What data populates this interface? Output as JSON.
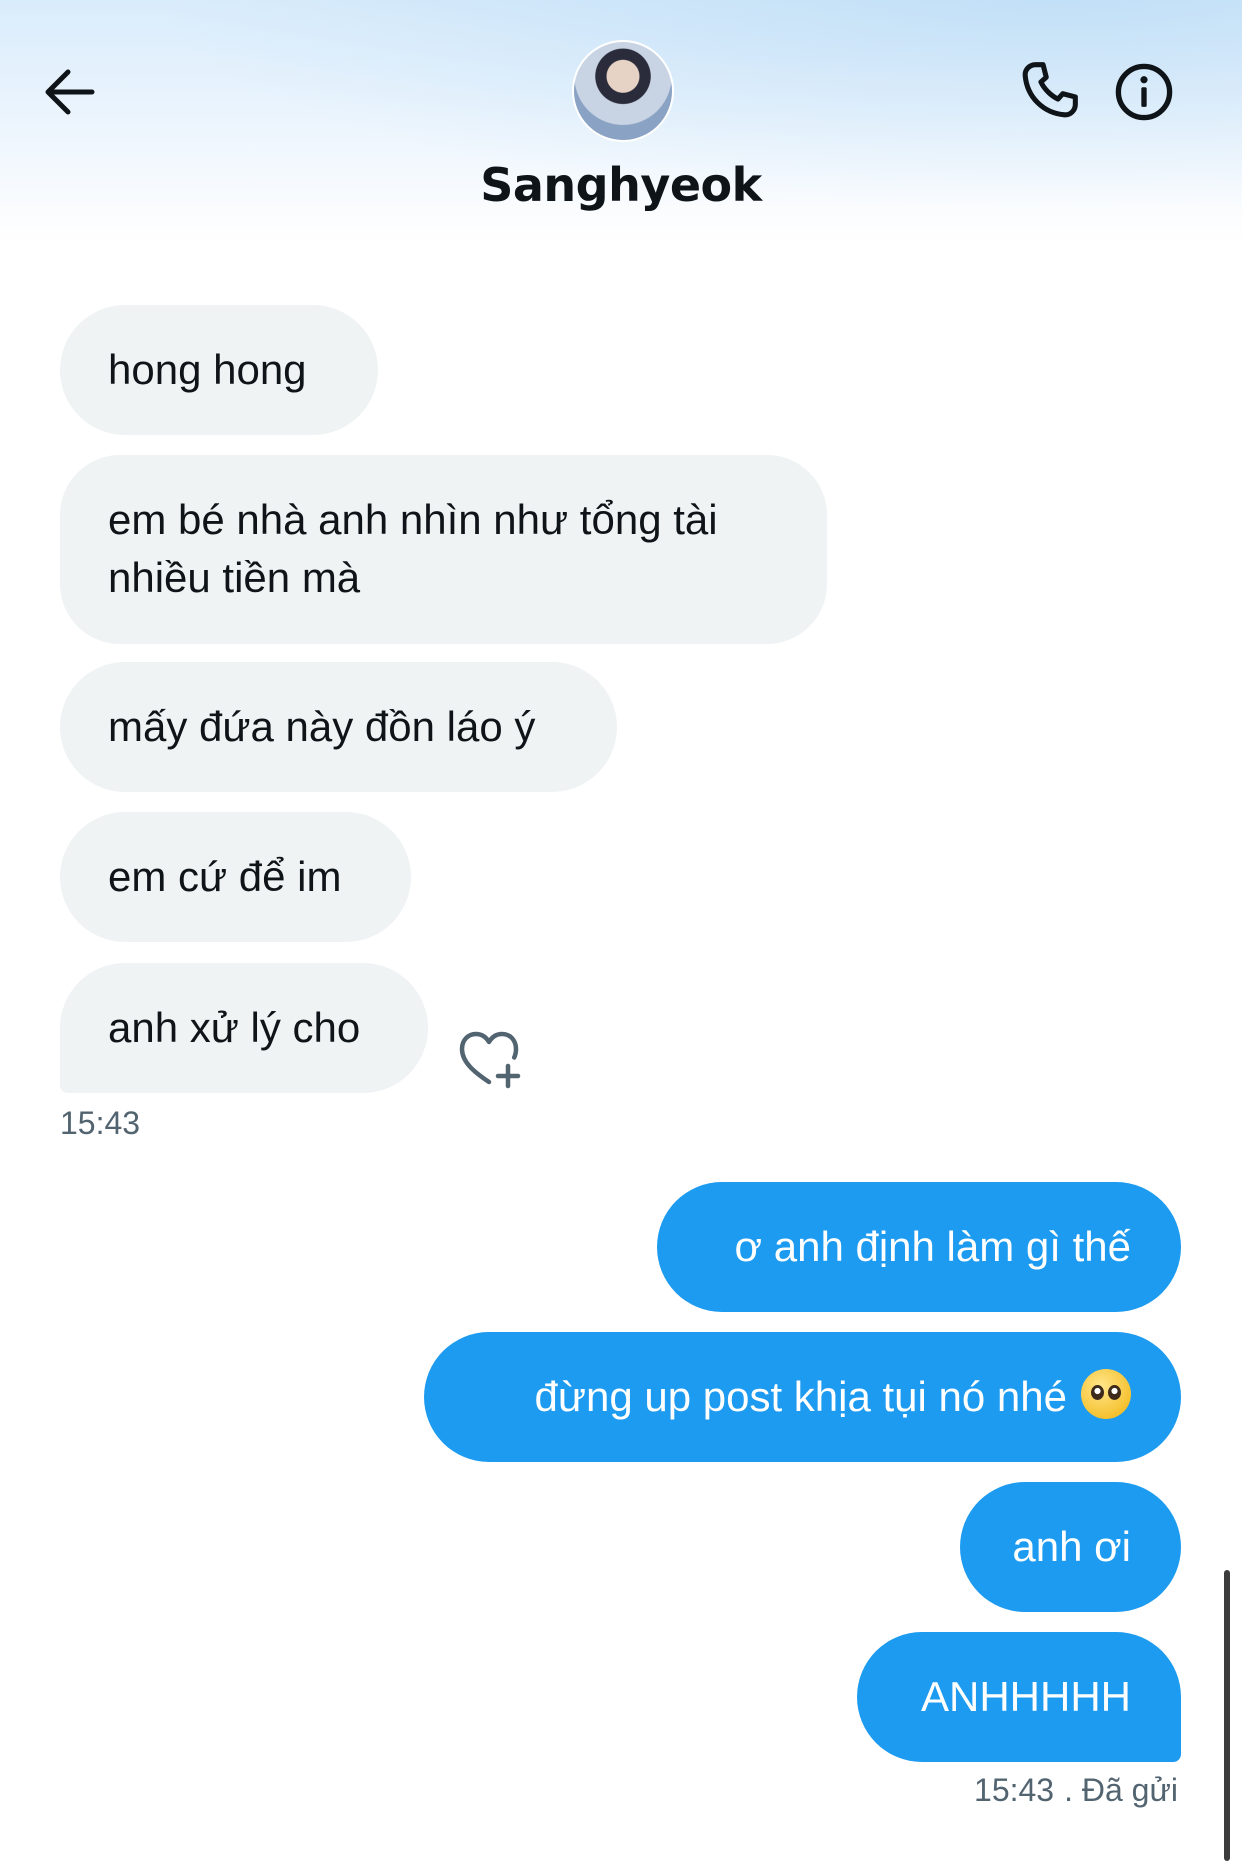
{
  "header": {
    "contact_name": "Sanghyeok",
    "back_icon": "arrow-left-icon",
    "call_icon": "phone-icon",
    "info_icon": "info-icon"
  },
  "messages_incoming": [
    "hong hong",
    "em bé nhà anh nhìn như tổng tài nhiều tiền mà",
    "mấy đứa này đồn láo ý",
    "em cứ để im",
    "anh xử lý cho"
  ],
  "incoming_time": "15:43",
  "messages_outgoing": [
    "ơ anh định làm gì thế",
    "đừng up post khịa tụi nó nhé",
    "anh ơi",
    "ANHHHHH"
  ],
  "outgoing_time": "15:43",
  "outgoing_status": ". Đã gửi",
  "colors": {
    "accent": "#1d9bf0",
    "incoming_bubble": "#eff3f4",
    "muted_text": "#536471"
  }
}
